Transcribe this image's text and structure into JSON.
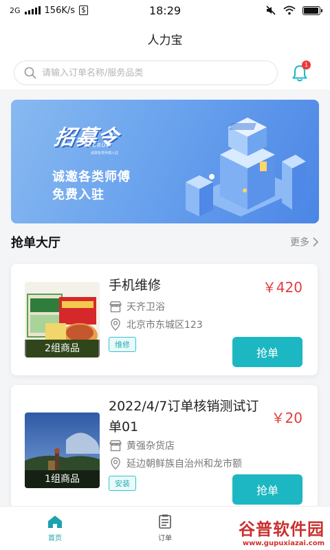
{
  "status_bar": {
    "network": "2G",
    "speed": "156K/s",
    "time": "18:29",
    "battery_level": 0.95
  },
  "header": {
    "title": "人力宝",
    "search_placeholder": "请输入订单名称/服务品类",
    "notification_count": "1"
  },
  "banner": {
    "logo_text": "招募令",
    "logo_sub": "RECRUIT",
    "logo_tiny": "诚邀各类师傅入驻",
    "line1": "诚邀各类师傅",
    "line2": "免费入驻"
  },
  "section": {
    "title": "抢单大厅",
    "more_label": "更多"
  },
  "orders": [
    {
      "title": "手机维修",
      "price": "￥420",
      "shop": "天齐卫浴",
      "address": "北京市东城区123",
      "tag": "维修",
      "item_count": "2组商品",
      "button": "抢单"
    },
    {
      "title": "2022/4/7订单核销测试订单01",
      "price": "￥20",
      "shop": "黄强杂货店",
      "address": "延边朝鲜族自治州和龙市额",
      "tag": "安装",
      "item_count": "1组商品",
      "button": "抢单"
    }
  ],
  "bottom_nav": {
    "items": [
      {
        "label": "首页",
        "icon": "home-icon",
        "active": true
      },
      {
        "label": "订单",
        "icon": "orders-icon",
        "active": false
      }
    ]
  },
  "watermark": {
    "main": "谷普软件园",
    "url": "www.gupuxiazai.com"
  },
  "colors": {
    "accent": "#1cb7c2",
    "price": "#e23c3c",
    "badge": "#ee3a3a"
  }
}
